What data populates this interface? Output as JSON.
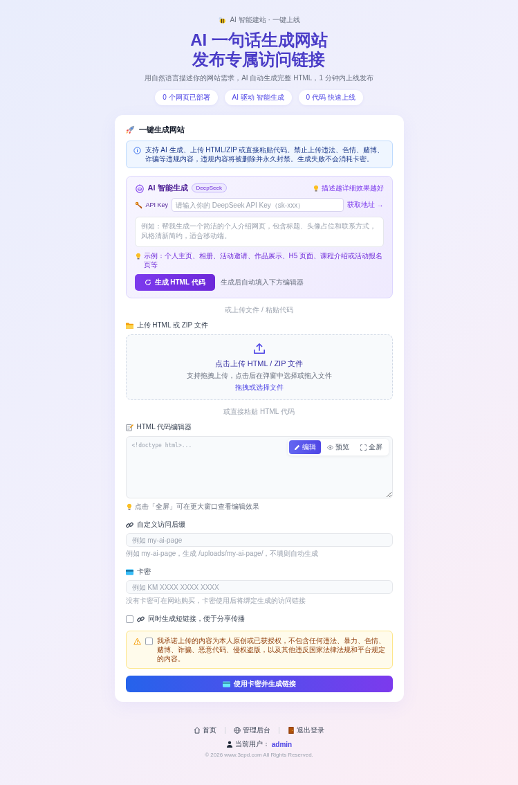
{
  "header": {
    "badge": "AI 智能建站 · 一键上线",
    "title_lines": [
      "AI 一句话生成网站",
      "发布专属访问链接"
    ],
    "subtitle": "用自然语言描述你的网站需求，AI 自动生成完整 HTML，1 分钟内上线发布",
    "pills": [
      "0 个网页已部署",
      "AI 驱动 智能生成",
      "0 代码 快速上线"
    ]
  },
  "card": {
    "title": "一键生成网站",
    "notice": "支持 AI 生成、上传 HTML/ZIP 或直接粘贴代码。禁止上传违法、色情、赌博、诈骗等违规内容，违规内容将被删除并永久封禁。生成失败不会消耗卡密。",
    "ai": {
      "title": "AI 智能生成",
      "model_badge": "DeepSeek",
      "tip": "描述越详细效果越好",
      "api_key": {
        "label": "API Key",
        "placeholder": "请输入你的 DeepSeek API Key（sk-xxx）",
        "link": "获取地址 →"
      },
      "prompt": {
        "placeholder": "例如：帮我生成一个简洁的个人介绍网页，包含标题、头像占位和联系方式，风格清新简约，适合移动端。"
      },
      "examples": "示例：个人主页、相册、活动邀请、作品展示、H5 页面、课程介绍或活动报名页等",
      "generate_button": "生成 HTML 代码",
      "generate_note": "生成后自动填入下方编辑器"
    },
    "divider_upload": "或上传文件 / 粘贴代码",
    "upload": {
      "label": "上传 HTML 或 ZIP 文件",
      "title": "点击上传 HTML / ZIP 文件",
      "hint": "支持拖拽上传，点击后在弹窗中选择或拖入文件",
      "link": "拖拽或选择文件"
    },
    "divider_paste": "或直接粘贴 HTML 代码",
    "editor": {
      "label": "HTML 代码编辑器",
      "placeholder": "<!doctype html>...",
      "tabs": [
        {
          "kind": "edit",
          "label": "编辑",
          "selected": true
        },
        {
          "kind": "preview",
          "label": "预览",
          "selected": false
        },
        {
          "kind": "fullscreen",
          "label": "全屏",
          "selected": false
        }
      ],
      "hint": "点击「全屏」可在更大窗口查看编辑效果"
    },
    "fields": [
      {
        "kind": "suffix",
        "label": "自定义访问后缀",
        "placeholder": "例如 my-ai-page",
        "help": "例如 my-ai-page，生成 /uploads/my-ai-page/，不填则自动生成"
      },
      {
        "kind": "card",
        "label": "卡密",
        "placeholder": "例如 KM XXXX XXXX XXXX",
        "help": "没有卡密可在网站购买，卡密使用后将绑定生成的访问链接"
      }
    ],
    "short_link": {
      "label": "同时生成短链接，便于分享传播",
      "checked": false
    },
    "agreement": {
      "text": "我承诺上传的内容为本人原创或已获授权，不包含任何违法、暴力、色情、赌博、诈骗、恶意代码、侵权盗版，以及其他违反国家法律法规和平台规定的内容。",
      "checked": false
    },
    "submit_button": "使用卡密并生成链接"
  },
  "footer": {
    "links": [
      {
        "kind": "home",
        "label": "首页"
      },
      {
        "kind": "admin",
        "label": "管理后台"
      },
      {
        "kind": "logout",
        "label": "退出登录"
      }
    ],
    "user_label": "当前用户：",
    "username": "admin",
    "copyright": "© 2026 www.3epd.com All Rights Reserved."
  }
}
